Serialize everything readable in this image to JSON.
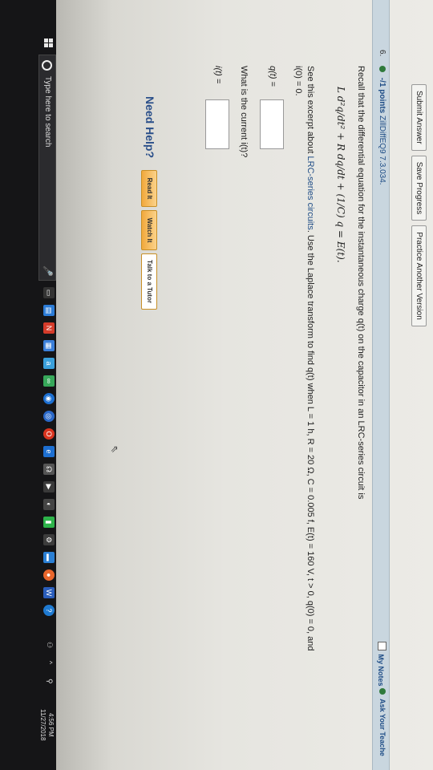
{
  "toolbar": {
    "submit_label": "Submit Answer",
    "save_label": "Save Progress",
    "practice_label": "Practice Another Version"
  },
  "question": {
    "number": "6.",
    "points": "-/1 points",
    "source": "ZillDiffEQ9 7.3.034.",
    "my_notes": "My Notes",
    "ask_teacher": "Ask Your Teache",
    "recall_text": "Recall that the differential equation for the instantaneous charge q(t) on the capacitor in an LRC-series circuit is",
    "formula": "L d²q/dt² + R dq/dt + (1/C) q = E(t).",
    "see_prefix": "See this excerpt about ",
    "see_link": "LRC-series circuits",
    "see_rest": ". Use the Laplace transform to find q(t) when L = 1 h, R = 20 Ω, C = 0.005 f, E(t) = 160 V, t > 0, q(0) = 0, and",
    "see_line2": "i(0) = 0.",
    "q_label": "q(t) =",
    "current_prompt": "What is the current i(t)?",
    "i_label": "i(t) =",
    "q_value": "",
    "i_value": ""
  },
  "help": {
    "need_help": "Need Help?",
    "read_it": "Read It",
    "watch_it": "Watch It",
    "talk_tutor": "Talk to a Tutor"
  },
  "taskbar": {
    "search_placeholder": "Type here to search",
    "time": "4:56 PM",
    "date": "11/27/2018"
  },
  "colors": {
    "link": "#1f4d86",
    "help_button": "#f1a93c",
    "question_bar": "#c9d6df",
    "taskbar": "#151517"
  }
}
